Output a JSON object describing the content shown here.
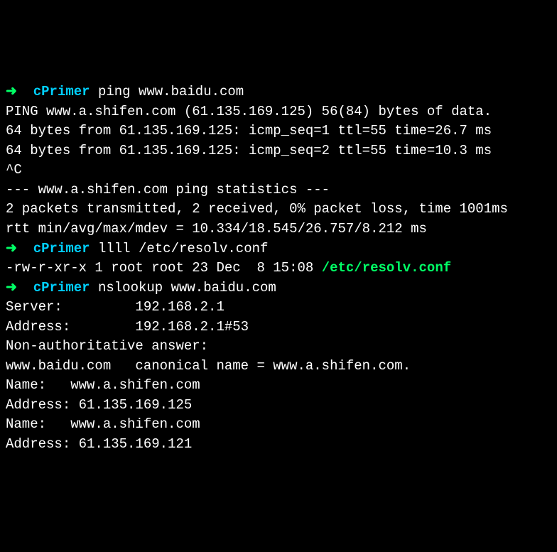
{
  "terminal": {
    "arrow": "➜",
    "host": "cPrimer",
    "cmd1": "ping www.baidu.com",
    "ping_header": "PING www.a.shifen.com (61.135.169.125) 56(84) bytes of data.",
    "ping_reply1": "64 bytes from 61.135.169.125: icmp_seq=1 ttl=55 time=26.7 ms",
    "ping_reply2": "64 bytes from 61.135.169.125: icmp_seq=2 ttl=55 time=10.3 ms",
    "interrupt": "^C",
    "stats_header": "--- www.a.shifen.com ping statistics ---",
    "stats_packets": "2 packets transmitted, 2 received, 0% packet loss, time 1001ms",
    "stats_rtt": "rtt min/avg/max/mdev = 10.334/18.545/26.757/8.212 ms",
    "cmd2": "llll /etc/resolv.conf",
    "ls_output_prefix": "-rw-r-xr-x 1 root root 23 Dec  8 15:08 ",
    "ls_output_file": "/etc/resolv.conf",
    "cmd3": "nslookup www.baidu.com",
    "ns_server": "Server:         192.168.2.1",
    "ns_address": "Address:        192.168.2.1#53",
    "blank": "",
    "ns_nonauth": "Non-authoritative answer:",
    "ns_cname": "www.baidu.com   canonical name = www.a.shifen.com.",
    "ns_name1": "Name:   www.a.shifen.com",
    "ns_addr1": "Address: 61.135.169.125",
    "ns_name2": "Name:   www.a.shifen.com",
    "ns_addr2": "Address: 61.135.169.121"
  }
}
